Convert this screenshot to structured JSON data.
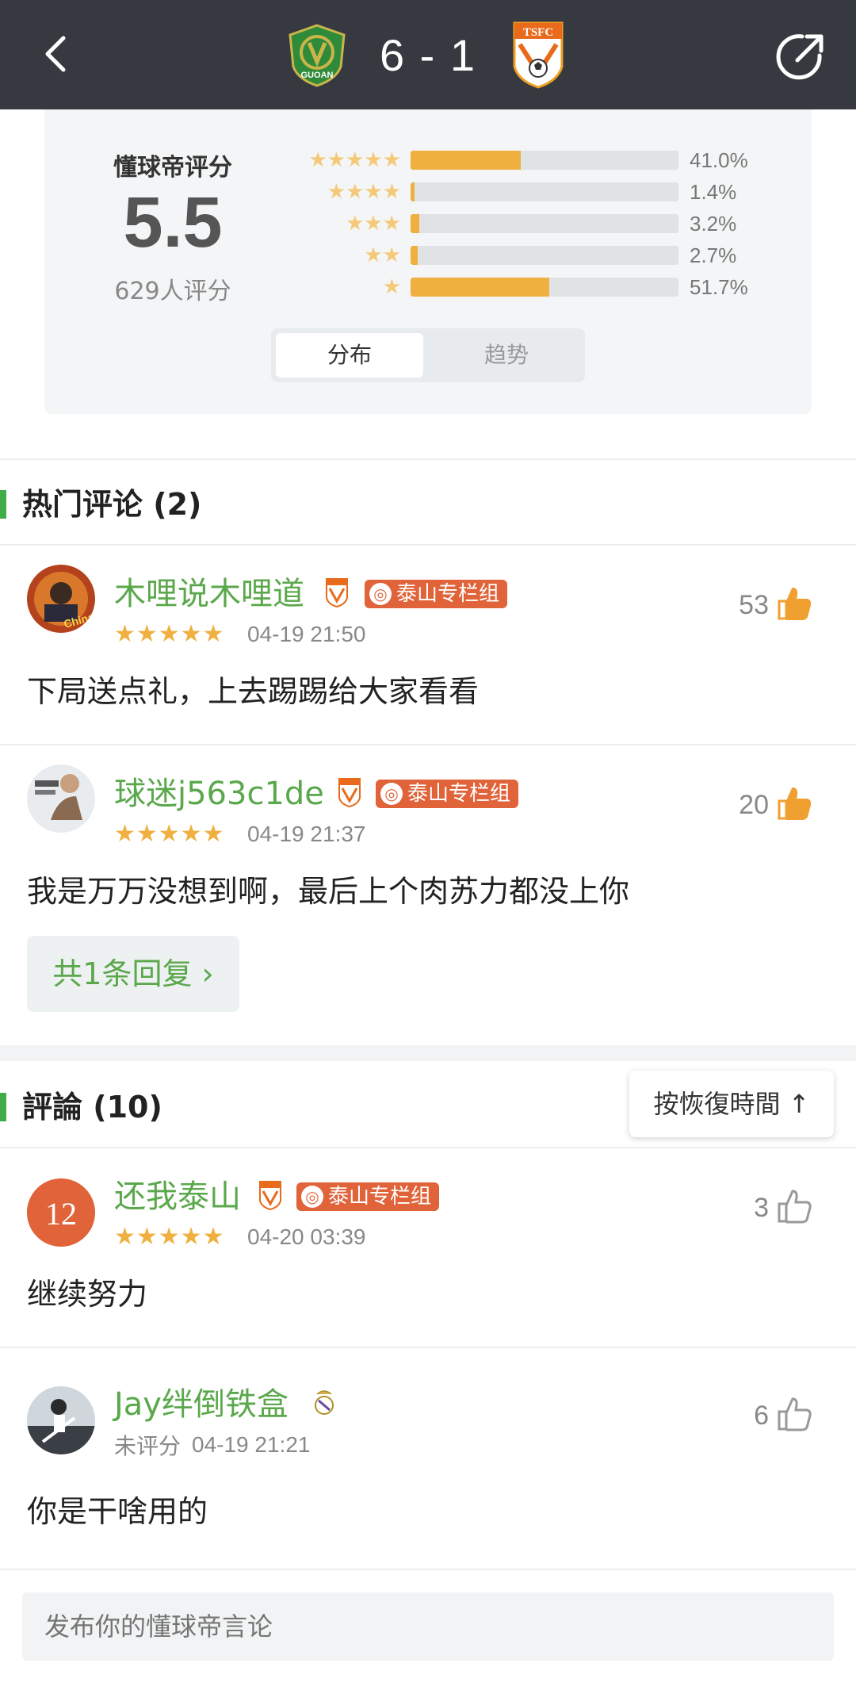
{
  "header": {
    "score": "6 - 1",
    "home_logo_text": "GUOAN",
    "away_logo_text": "TSFC"
  },
  "rating": {
    "title": "懂球帝评分",
    "score": "5.5",
    "count": "629人评分",
    "distribution": [
      {
        "stars": 5,
        "percent_label": "41.0%",
        "percent": 41.0
      },
      {
        "stars": 4,
        "percent_label": "1.4%",
        "percent": 1.4
      },
      {
        "stars": 3,
        "percent_label": "3.2%",
        "percent": 3.2
      },
      {
        "stars": 2,
        "percent_label": "2.7%",
        "percent": 2.7
      },
      {
        "stars": 1,
        "percent_label": "51.7%",
        "percent": 51.7
      }
    ],
    "tabs": {
      "active": "分布",
      "inactive": "趋势"
    }
  },
  "hot": {
    "title": "热门评论 (2)",
    "comments": [
      {
        "username": "木哩说木哩道",
        "tag": "泰山专栏组",
        "stars": "★★★★★",
        "time": "04-19 21:50",
        "likes": "53",
        "content": "下局送点礼，上去踢踢给大家看看"
      },
      {
        "username": "球迷j563c1de",
        "tag": "泰山专栏组",
        "stars": "★★★★★",
        "time": "04-19 21:37",
        "likes": "20",
        "content": "我是万万没想到啊，最后上个肉苏力都没上你",
        "reply_label": "共1条回复"
      }
    ]
  },
  "all": {
    "title": "評論 (10)",
    "sort_label": "按恢復時間",
    "comments": [
      {
        "username": "还我泰山",
        "tag": "泰山专栏组",
        "avatar_text": "12",
        "stars": "★★★★★",
        "time": "04-20 03:39",
        "likes": "3",
        "content": "继续努力"
      },
      {
        "username": "Jay绊倒铁盒",
        "rating_label": "未评分",
        "time": "04-19 21:21",
        "likes": "6",
        "content": "你是干啥用的"
      }
    ]
  },
  "composer": {
    "placeholder": "发布你的懂球帝言论"
  },
  "colors": {
    "topbar": "#363a40",
    "accent_green": "#5aa84b",
    "section_bar": "#3fae49",
    "star_gold": "#f0b040",
    "tag_orange": "#e0633a"
  }
}
